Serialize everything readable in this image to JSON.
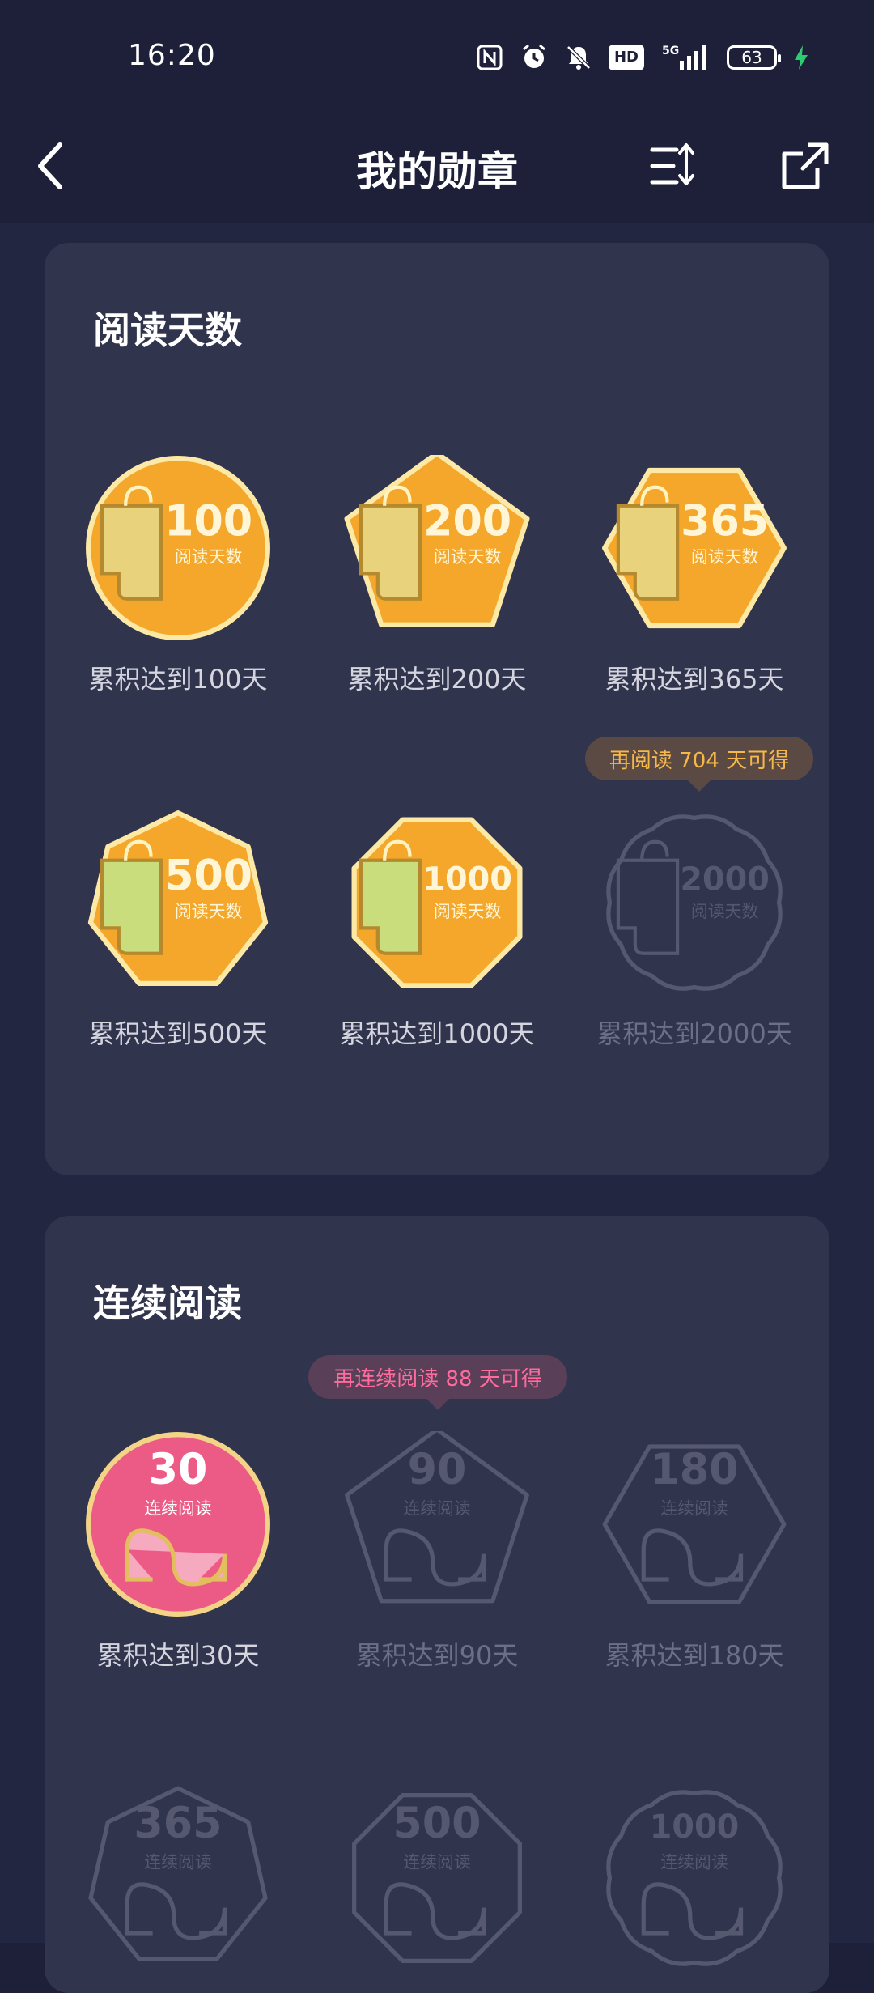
{
  "status_bar": {
    "time": "16:20",
    "icons": [
      "nfc-icon",
      "alarm-icon",
      "mute-icon",
      "hd-voice-icon",
      "5g-signal-icon",
      "battery-icon",
      "charging-icon"
    ],
    "hd_label": "HD",
    "network_label": "5G",
    "battery_level": "63"
  },
  "app_bar": {
    "title": "我的勋章",
    "back_icon": "chevron-left-icon",
    "sort_icon": "sort-icon",
    "share_icon": "share-icon"
  },
  "colors": {
    "background": "#1e2039",
    "card": "#31344d",
    "gold": "#f5a623",
    "green": "#c6d97a",
    "pink": "#ee5c86",
    "locked": "#55586f"
  },
  "sections": [
    {
      "title": "阅读天数",
      "tooltip": "再阅读 704 天可得",
      "badges": [
        {
          "number": "100",
          "subtitle": "阅读天数",
          "caption": "累积达到100天",
          "shape": "circle",
          "state": "earned",
          "color": "gold"
        },
        {
          "number": "200",
          "subtitle": "阅读天数",
          "caption": "累积达到200天",
          "shape": "pentagon",
          "state": "earned",
          "color": "gold"
        },
        {
          "number": "365",
          "subtitle": "阅读天数",
          "caption": "累积达到365天",
          "shape": "hexagon",
          "state": "earned",
          "color": "gold"
        },
        {
          "number": "500",
          "subtitle": "阅读天数",
          "caption": "累积达到500天",
          "shape": "heptagon",
          "state": "earned",
          "color": "green"
        },
        {
          "number": "1000",
          "subtitle": "阅读天数",
          "caption": "累积达到1000天",
          "shape": "octagon",
          "state": "earned",
          "color": "green"
        },
        {
          "number": "2000",
          "subtitle": "阅读天数",
          "caption": "累积达到2000天",
          "shape": "scalloped",
          "state": "locked",
          "color": "locked"
        }
      ]
    },
    {
      "title": "连续阅读",
      "tooltip": "再连续阅读 88 天可得",
      "badges": [
        {
          "number": "30",
          "subtitle": "连续阅读",
          "caption": "累积达到30天",
          "shape": "circle",
          "state": "earned",
          "color": "pink"
        },
        {
          "number": "90",
          "subtitle": "连续阅读",
          "caption": "累积达到90天",
          "shape": "pentagon",
          "state": "locked",
          "color": "locked"
        },
        {
          "number": "180",
          "subtitle": "连续阅读",
          "caption": "累积达到180天",
          "shape": "hexagon",
          "state": "locked",
          "color": "locked"
        },
        {
          "number": "365",
          "subtitle": "连续阅读",
          "caption": "",
          "shape": "heptagon",
          "state": "locked",
          "color": "locked"
        },
        {
          "number": "500",
          "subtitle": "连续阅读",
          "caption": "",
          "shape": "octagon",
          "state": "locked",
          "color": "locked"
        },
        {
          "number": "1000",
          "subtitle": "连续阅读",
          "caption": "",
          "shape": "scalloped",
          "state": "locked",
          "color": "locked"
        }
      ]
    }
  ]
}
